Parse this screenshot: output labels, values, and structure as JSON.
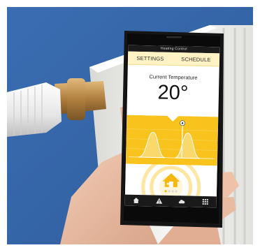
{
  "app": {
    "title": "Heating Control"
  },
  "nav": {
    "tabs": [
      "SETTINGS",
      "SCHEDULE"
    ]
  },
  "temperature": {
    "label": "Current Temperature",
    "value": "20°"
  },
  "pager": {
    "pages": 4,
    "active": 1
  },
  "bottom_nav": {
    "icons": [
      "home-icon",
      "warning-icon",
      "cloud-icon",
      "grid-icon"
    ]
  },
  "colors": {
    "accent": "#f7c31c",
    "nav_background": "#fff2c4",
    "wall": "#3b70b6",
    "radiator": "#f3f3f1"
  }
}
